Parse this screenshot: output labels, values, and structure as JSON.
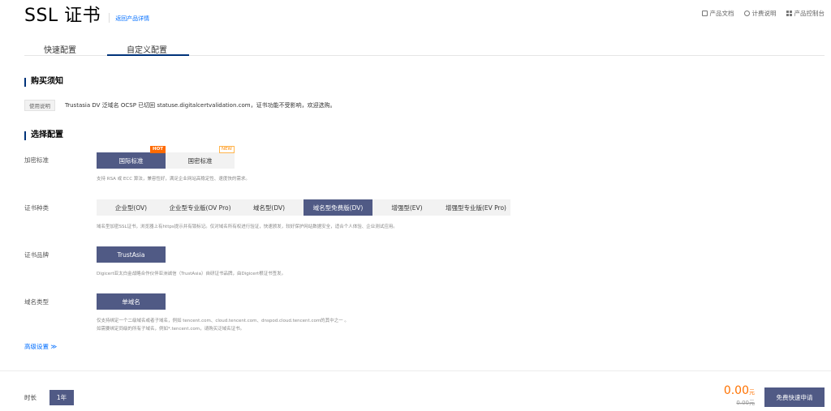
{
  "header": {
    "title": "SSL 证书",
    "back_link": "返回产品详情",
    "links": [
      {
        "label": "产品文档",
        "icon": "document-icon"
      },
      {
        "label": "计费说明",
        "icon": "info-icon"
      },
      {
        "label": "产品控制台",
        "icon": "grid-icon"
      }
    ]
  },
  "tabs": [
    "快速配置",
    "自定义配置"
  ],
  "active_tab": "自定义配置",
  "notice": {
    "title": "购买须知",
    "tag": "使用说明",
    "text": "Trustasia DV 泛域名 OCSP 已切回 statuse.digitalcertvalidation.com，证书功能不受影响，欢迎选购。"
  },
  "config": {
    "title": "选择配置",
    "encryption": {
      "label": "加密标准",
      "options": [
        "国际标准",
        "国密标准"
      ],
      "selected": "国际标准",
      "badges": [
        "HOT",
        "NEW"
      ],
      "desc": "支持 RSA 或 ECC 算法，兼容性好，满足企业网站高稳定性、速度快的需求。"
    },
    "cert_type": {
      "label": "证书种类",
      "options": [
        "企业型(OV)",
        "企业型专业版(OV Pro)",
        "域名型(DV)",
        "域名型免费版(DV)",
        "增强型(EV)",
        "增强型专业版(EV Pro)"
      ],
      "selected": "域名型免费版(DV)",
      "desc": "域名型加密SSL证书，浏览器上有https提示并有锁标记。仅对域名所有权进行验证，快速颁发，较好保护网站数据安全，适合个人体验、企业测试应用。"
    },
    "brand": {
      "label": "证书品牌",
      "option": "TrustAsia",
      "desc": "Digicert亚太白金战略合作伙伴亚洲诚信（TrustAsia）自研证书品牌，由Digicert根证书签发。"
    },
    "domain_type": {
      "label": "域名类型",
      "option": "单域名",
      "desc_1": "仅支持绑定一个二级域名或者子域名，例如 tencent.com、cloud.tencent.com、dnspod.cloud.tencent.com的其中之一 。",
      "desc_2": "如需要绑定同级的所有子域名，例如*.tencent.com，请购买泛域名证书。"
    },
    "advanced": "高级设置"
  },
  "footer": {
    "duration_label": "时长",
    "duration_value": "1年",
    "price": "0.00",
    "price_unit": "元",
    "original_price": "0.00元",
    "apply_button": "免费快速申请"
  },
  "colors": {
    "accent": "#505a85",
    "link": "#006eff",
    "price": "#ff7200",
    "hot": "#ff6a00"
  }
}
